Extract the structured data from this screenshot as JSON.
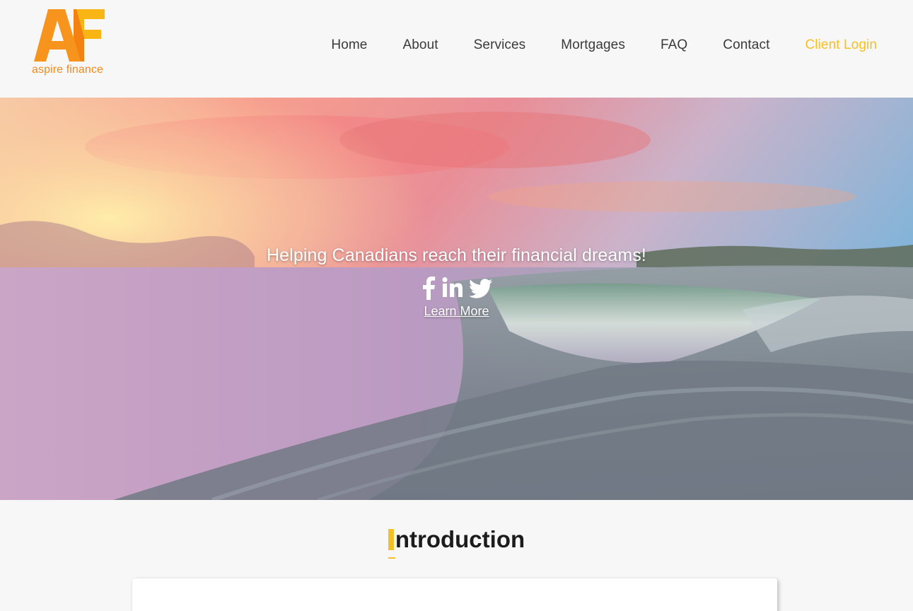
{
  "logo": {
    "text": "aspire finance",
    "colors": {
      "orange": "#f7941d",
      "dark_orange": "#f27c13",
      "yellow": "#f9b513"
    }
  },
  "nav": {
    "items": [
      {
        "label": "Home"
      },
      {
        "label": "About"
      },
      {
        "label": "Services"
      },
      {
        "label": "Mortgages"
      },
      {
        "label": "FAQ"
      },
      {
        "label": "Contact"
      }
    ],
    "login_label": "Client Login",
    "accent_color": "#f4c025"
  },
  "hero": {
    "tagline": "Helping Canadians reach their financial dreams!",
    "socials": [
      {
        "icon": "facebook-icon"
      },
      {
        "icon": "linkedin-icon"
      },
      {
        "icon": "twitter-icon"
      }
    ],
    "cta_label": "Learn More"
  },
  "intro": {
    "title": "Introduction",
    "first_letter": "I",
    "rest": "ntroduction"
  }
}
